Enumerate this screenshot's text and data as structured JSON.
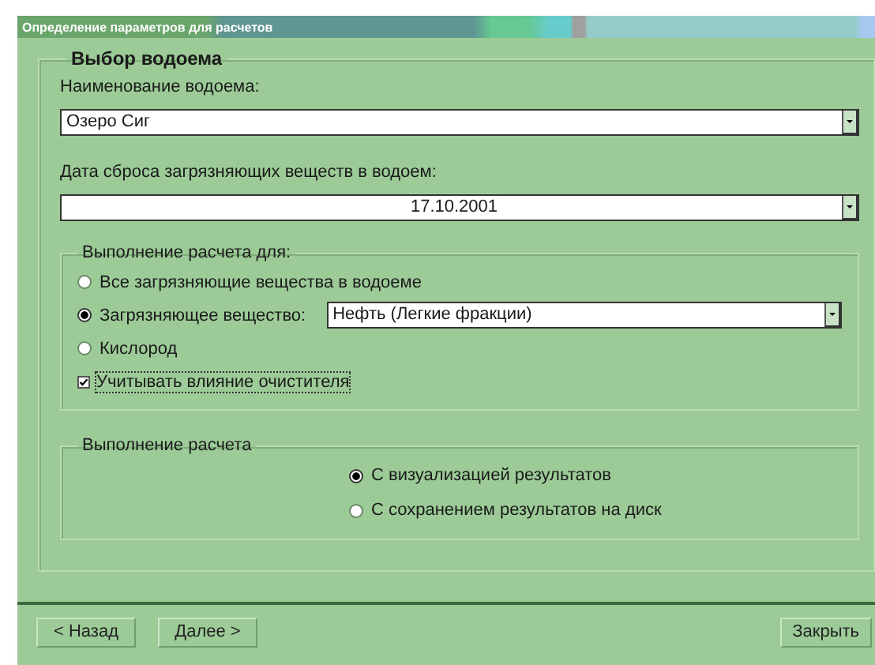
{
  "window": {
    "title": "Определение параметров  для расчетов"
  },
  "water_body_group": {
    "title": "Выбор водоема",
    "name_label": "Наименование водоема:",
    "name_value": "Озеро Сиг",
    "date_label": "Дата сброса загрязняющих веществ в водоем:",
    "date_value": "17.10.2001",
    "calc_for": {
      "title": "Выполнение расчета для:",
      "options": [
        {
          "label": "Все загрязняющие вещества в водоеме",
          "selected": false
        },
        {
          "label": "Загрязняющее вещество:",
          "selected": true,
          "substance": "Нефть (Легкие фракции)"
        },
        {
          "label": "Кислород",
          "selected": false
        }
      ],
      "account_cleaner": {
        "label": "Учитывать влияние очистителя",
        "checked": true
      }
    },
    "calc_mode": {
      "title": "Выполнение расчета",
      "options": [
        {
          "label": "С визуализацией результатов",
          "selected": true
        },
        {
          "label": "С сохранением результатов на диск",
          "selected": false
        }
      ]
    }
  },
  "buttons": [
    {
      "label": "< Назад",
      "kind": "back"
    },
    {
      "label": "Далее >",
      "kind": "next"
    },
    {
      "label": "Закрыть",
      "kind": "close"
    }
  ]
}
